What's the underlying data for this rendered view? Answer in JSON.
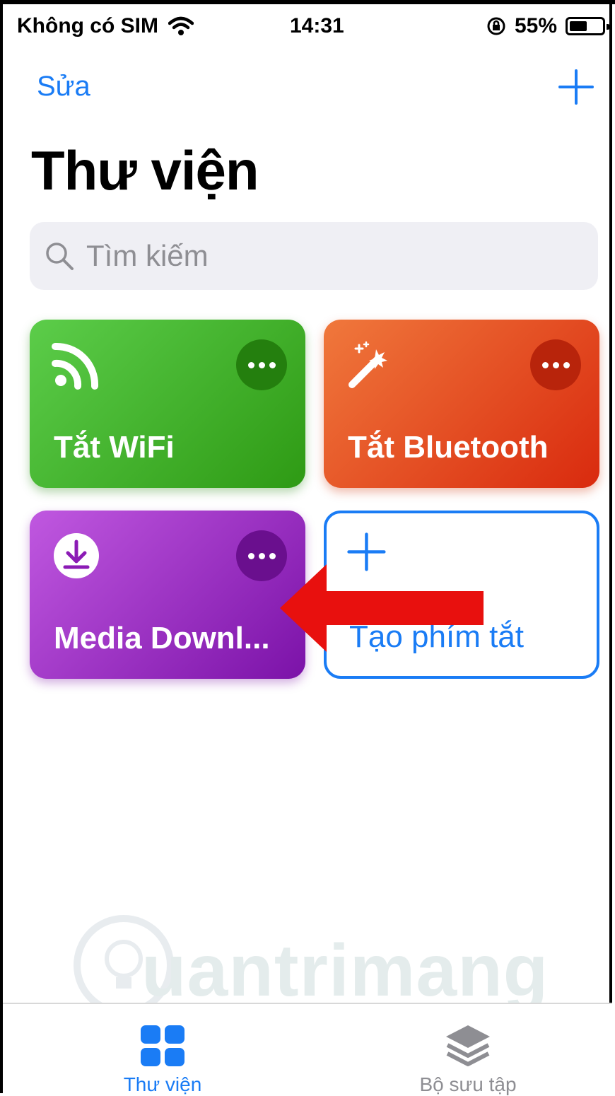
{
  "status_bar": {
    "carrier": "Không có SIM",
    "time": "14:31",
    "battery": "55%",
    "battery_level": 0.55
  },
  "nav": {
    "edit_label": "Sửa",
    "add_icon": "plus-icon"
  },
  "page_title": "Thư viện",
  "search": {
    "placeholder": "Tìm kiếm",
    "icon": "search-icon"
  },
  "shortcuts": [
    {
      "name": "Tắt WiFi",
      "icon": "wifi-signal-icon",
      "color_from": "#5ccd4a",
      "color_to": "#2e9a14"
    },
    {
      "name": "Tắt Bluetooth",
      "icon": "magic-wand-icon",
      "color_from": "#f0783c",
      "color_to": "#d92a0e"
    },
    {
      "name": "Media Downl...",
      "icon": "download-icon",
      "color_from": "#c058e0",
      "color_to": "#7b12a8"
    }
  ],
  "create_shortcut": {
    "label": "Tạo phím tắt",
    "icon": "plus-icon"
  },
  "tabs": [
    {
      "label": "Thư viện",
      "icon": "grid-icon",
      "active": true
    },
    {
      "label": "Bộ sưu tập",
      "icon": "layers-icon",
      "active": false
    }
  ],
  "colors": {
    "accent": "#1a7cf5",
    "annotation_arrow": "#e8100e"
  }
}
